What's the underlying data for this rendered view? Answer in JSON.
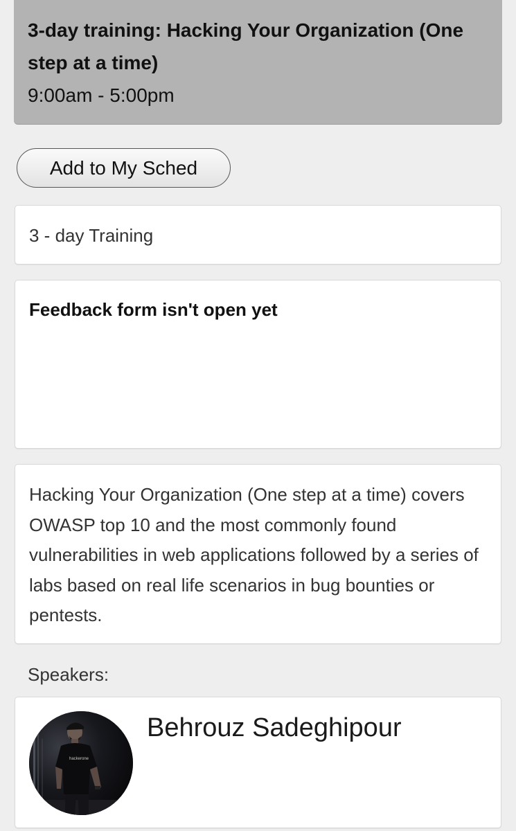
{
  "session": {
    "title": "3-day training: Hacking Your Organization (One step at a time)",
    "time": "9:00am - 5:00pm",
    "add_button_label": "Add to My Sched",
    "type": "3 - day Training",
    "feedback_status": "Feedback form isn't open yet",
    "description": "Hacking Your Organization (One step at a time) covers OWASP top 10  and the most commonly found vulnerabilities in web applications followed by a series of labs based on real life scenarios in bug bounties or pentests."
  },
  "speakers": {
    "label": "Speakers:",
    "items": [
      {
        "name": "Behrouz Sadeghipour",
        "avatar_icon": "speaker-photo",
        "shirt_text": "hackerone"
      }
    ]
  },
  "colors": {
    "page_background": "#efeeef",
    "header_background": "#b3b3b3",
    "card_background": "#ffffff"
  }
}
